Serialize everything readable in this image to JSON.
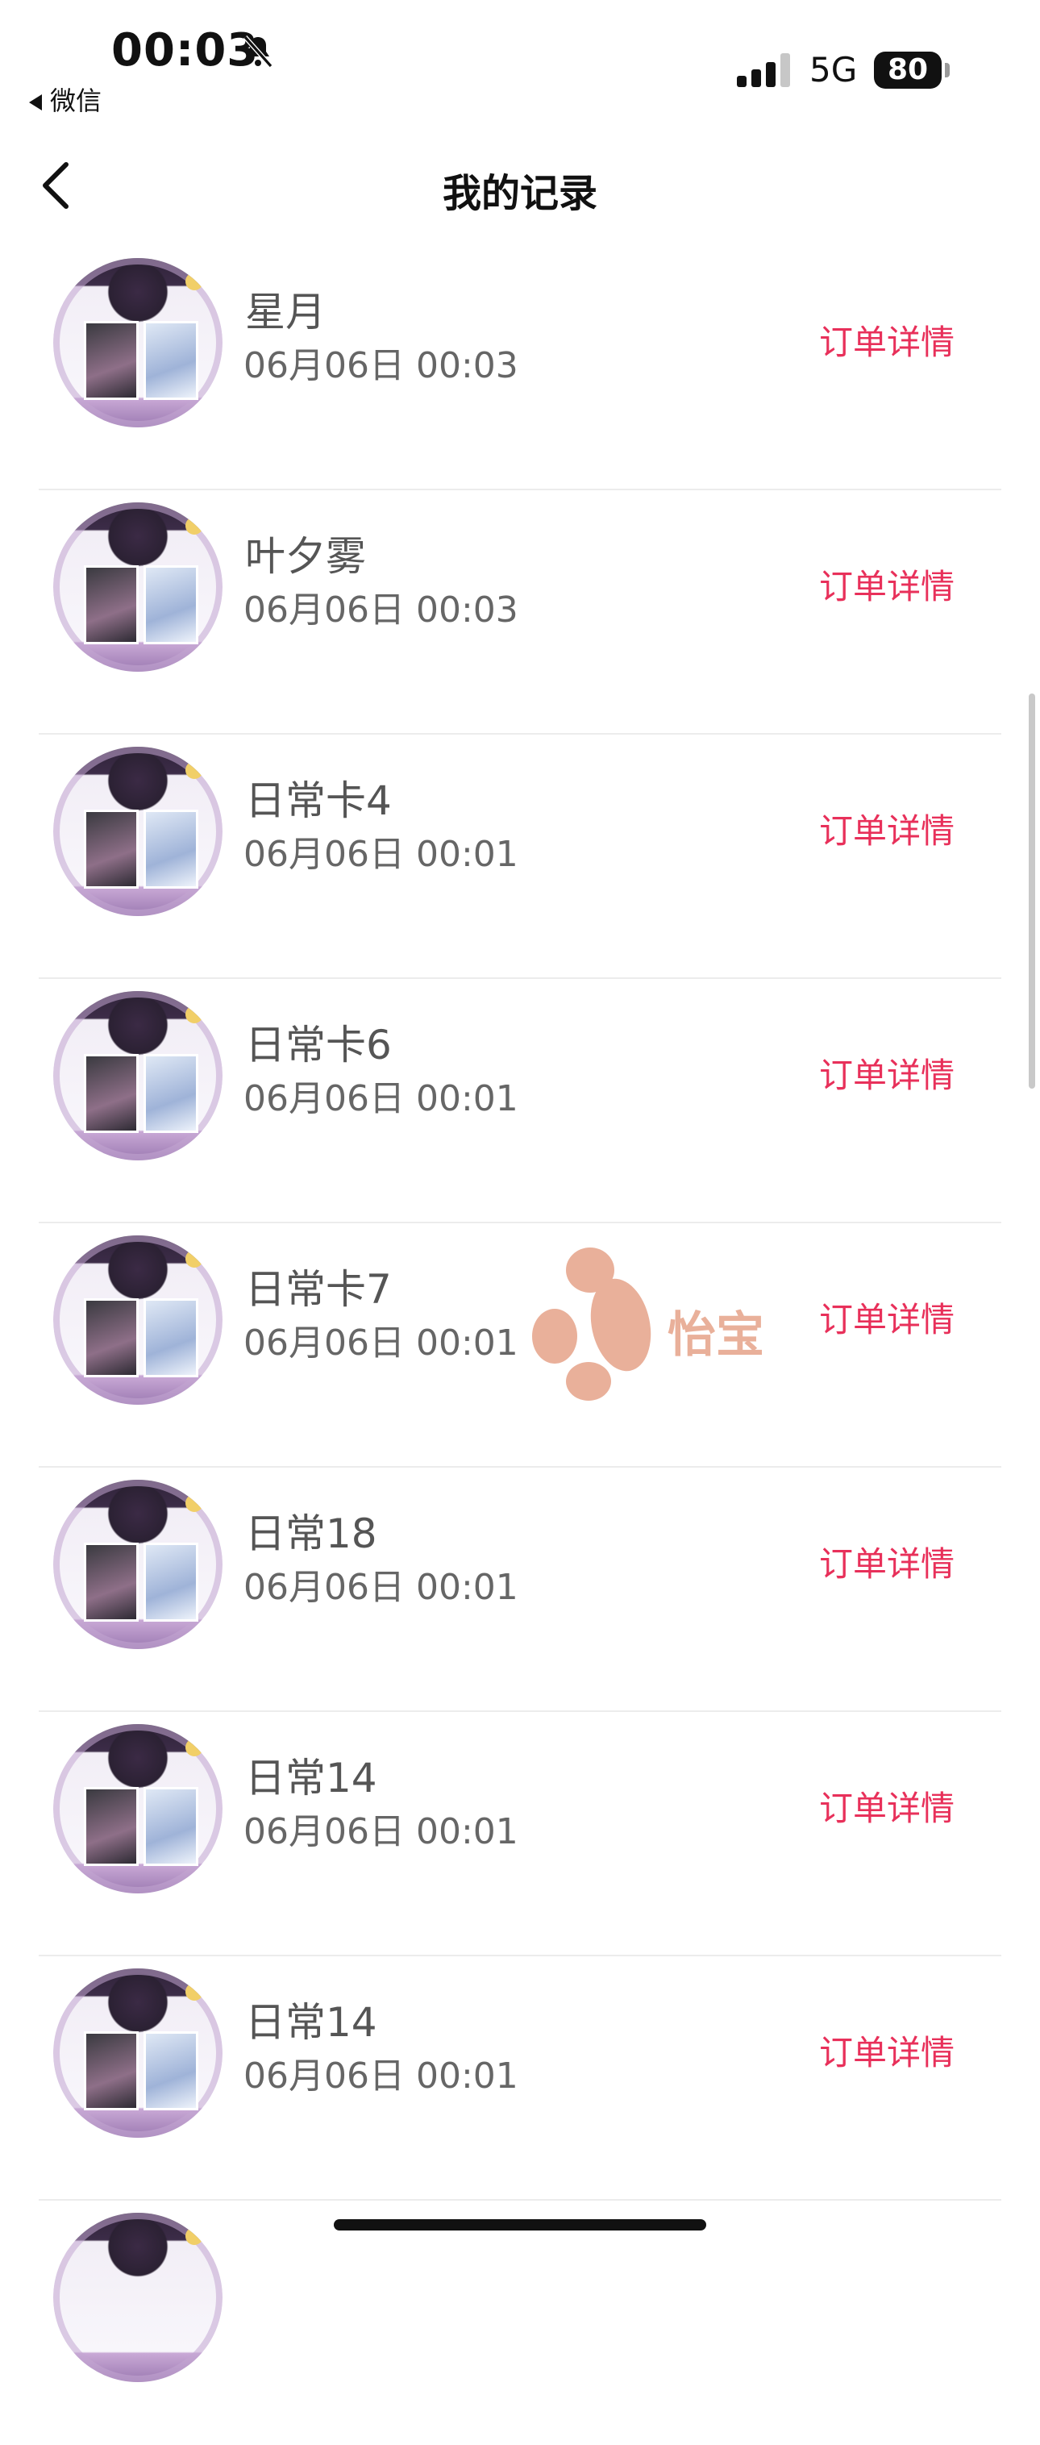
{
  "status_bar": {
    "time": "00:03",
    "back_app": "微信",
    "network": "5G",
    "battery": "80",
    "icons": [
      "bell-slash-icon",
      "signal-icon",
      "battery-icon"
    ]
  },
  "nav": {
    "title": "我的记录",
    "back_icon": "chevron-left-icon"
  },
  "records": [
    {
      "name": "星月",
      "time": "06月06日 00:03",
      "action": "订单详情"
    },
    {
      "name": "叶夕雾",
      "time": "06月06日 00:03",
      "action": "订单详情"
    },
    {
      "name": "日常卡4",
      "time": "06月06日 00:01",
      "action": "订单详情"
    },
    {
      "name": "日常卡6",
      "time": "06月06日 00:01",
      "action": "订单详情"
    },
    {
      "name": "日常卡7",
      "time": "06月06日 00:01",
      "action": "订单详情"
    },
    {
      "name": "日常18",
      "time": "06月06日 00:01",
      "action": "订单详情"
    },
    {
      "name": "日常14",
      "time": "06月06日 00:01",
      "action": "订单详情"
    },
    {
      "name": "日常14",
      "time": "06月06日 00:01",
      "action": "订单详情"
    }
  ],
  "watermark": {
    "text": "怡宝",
    "icon": "paw-icon"
  },
  "colors": {
    "accent": "#e8305a",
    "watermark": "#e9b09a"
  }
}
